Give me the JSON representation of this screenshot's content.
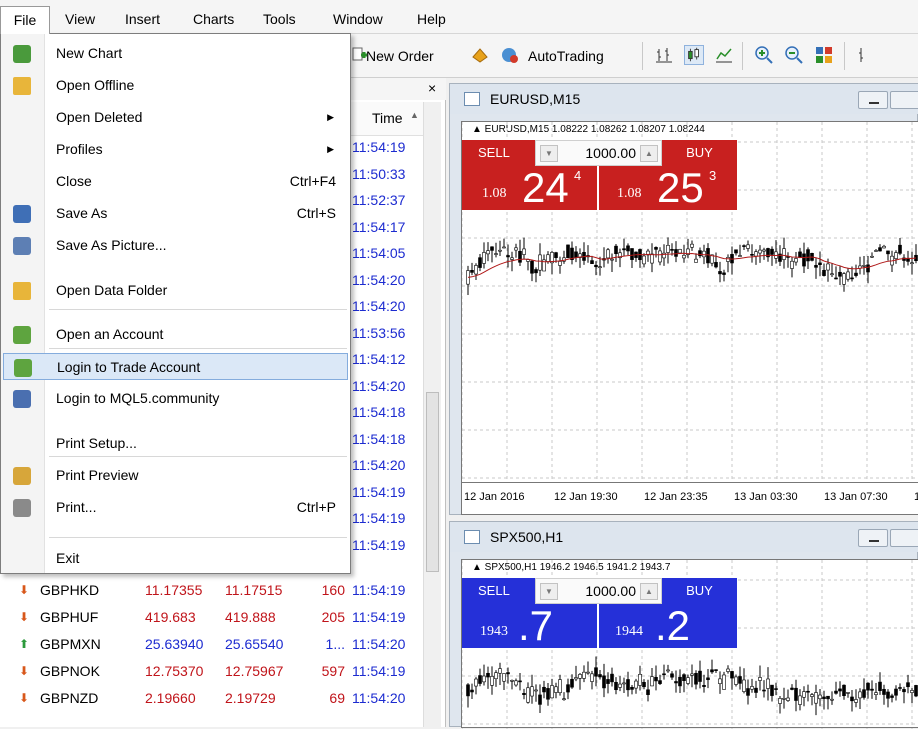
{
  "menubar": [
    "File",
    "View",
    "Insert",
    "Charts",
    "Tools",
    "Window",
    "Help"
  ],
  "toolbar": {
    "new_order": "New Order",
    "autotrading": "AutoTrading"
  },
  "file_menu": [
    {
      "label": "New Chart",
      "shortcut": "",
      "icon": "new-chart-icon"
    },
    {
      "label": "Open Offline",
      "shortcut": "",
      "icon": "folder-icon"
    },
    {
      "label": "Open Deleted",
      "shortcut": "",
      "submenu": true
    },
    {
      "label": "Profiles",
      "shortcut": "",
      "submenu": true
    },
    {
      "label": "Close",
      "shortcut": "Ctrl+F4"
    },
    {
      "label": "Save As",
      "shortcut": "Ctrl+S",
      "icon": "save-icon"
    },
    {
      "label": "Save As Picture...",
      "shortcut": "",
      "icon": "picture-icon"
    },
    {
      "label": "Open Data Folder",
      "shortcut": "",
      "icon": "folder-icon"
    },
    {
      "label": "Open an Account",
      "shortcut": "",
      "icon": "account-icon"
    },
    {
      "label": "Login to Trade Account",
      "shortcut": "",
      "icon": "login-icon",
      "highlighted": true
    },
    {
      "label": "Login to MQL5.community",
      "shortcut": "",
      "icon": "mql5-icon"
    },
    {
      "label": "Print Setup...",
      "shortcut": ""
    },
    {
      "label": "Print Preview",
      "shortcut": "",
      "icon": "print-preview-icon"
    },
    {
      "label": "Print...",
      "shortcut": "Ctrl+P",
      "icon": "printer-icon"
    },
    {
      "label": "Exit",
      "shortcut": ""
    }
  ],
  "market_watch": {
    "close": "×",
    "time_header": "Time",
    "times": [
      "11:54:19",
      "11:50:33",
      "11:52:37",
      "11:54:17",
      "11:54:05",
      "11:54:20",
      "11:54:20",
      "11:53:56",
      "11:54:12",
      "11:54:20",
      "11:54:18",
      "11:54:18",
      "11:54:20",
      "11:54:19",
      "11:54:19",
      "11:54:19"
    ],
    "rows": [
      {
        "symbol": "GBPHKD",
        "bid": "11.17355",
        "ask": "11.17515",
        "spread": "160",
        "time": "11:54:19",
        "dir": "down",
        "color": "#c0141a"
      },
      {
        "symbol": "GBPHUF",
        "bid": "419.683",
        "ask": "419.888",
        "spread": "205",
        "time": "11:54:19",
        "dir": "down",
        "color": "#c0141a"
      },
      {
        "symbol": "GBPMXN",
        "bid": "25.63940",
        "ask": "25.65540",
        "spread": "1...",
        "time": "11:54:20",
        "dir": "up",
        "color": "#1c2bd0"
      },
      {
        "symbol": "GBPNOK",
        "bid": "12.75370",
        "ask": "12.75967",
        "spread": "597",
        "time": "11:54:19",
        "dir": "down",
        "color": "#c0141a"
      },
      {
        "symbol": "GBPNZD",
        "bid": "2.19660",
        "ask": "2.19729",
        "spread": "69",
        "time": "11:54:20",
        "dir": "down",
        "color": "#c0141a"
      }
    ]
  },
  "charts": [
    {
      "title": "EURUSD,M15",
      "info": "▲ EURUSD,M15  1.08222 1.08262 1.08207 1.08244",
      "sell": "SELL",
      "buy": "BUY",
      "lot": "1000.00",
      "sell_small": "1.08",
      "sell_big": "24",
      "sell_sup": "4",
      "buy_small": "1.08",
      "buy_big": "25",
      "buy_sup": "3",
      "color": "#c8201f",
      "axis": [
        "12 Jan 2016",
        "12 Jan 19:30",
        "12 Jan 23:35",
        "13 Jan 03:30",
        "13 Jan 07:30",
        "1"
      ]
    },
    {
      "title": "SPX500,H1",
      "info": "▲ SPX500,H1  1946.2 1946.5 1941.2 1943.7",
      "sell": "SELL",
      "buy": "BUY",
      "lot": "1000.00",
      "sell_small": "1943",
      "sell_big": ".7",
      "sell_sup": "",
      "buy_small": "1944",
      "buy_big": ".2",
      "buy_sup": "",
      "color": "#2530d8"
    }
  ]
}
